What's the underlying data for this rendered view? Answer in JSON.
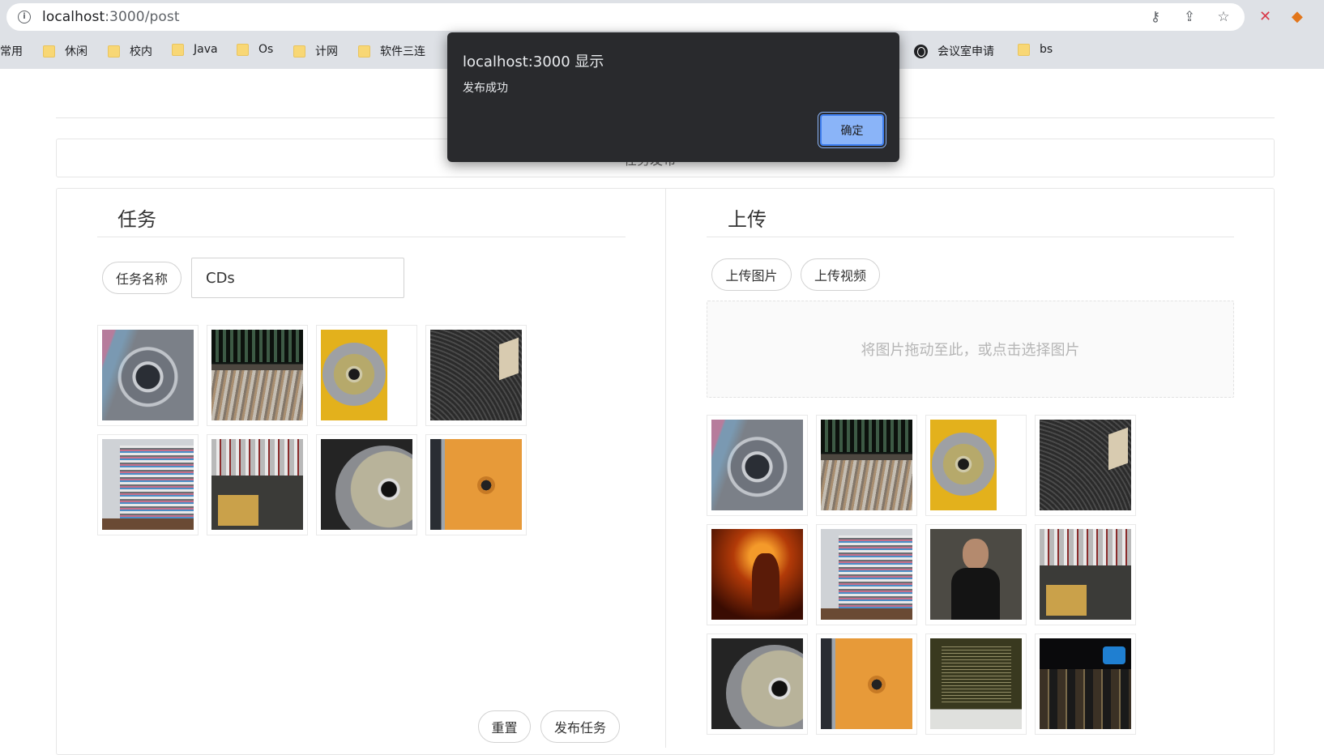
{
  "browser": {
    "url_host": "localhost",
    "url_path": ":3000/post",
    "bookmarks": [
      "常用",
      "休闲",
      "校内",
      "Java",
      "Os",
      "计网",
      "软件三连",
      "会议室申请",
      "bs"
    ]
  },
  "banner_text": "任务发布",
  "task": {
    "title": "任务",
    "name_label": "任务名称",
    "name_value": "CDs",
    "reset_label": "重置",
    "publish_label": "发布任务",
    "images": [
      "cd-case",
      "record-shelf",
      "gold-cd",
      "vinyl",
      "cd-store",
      "store-bins",
      "cd-in-case",
      "orange-cd"
    ]
  },
  "upload": {
    "title": "上传",
    "upload_image_label": "上传图片",
    "upload_video_label": "上传视频",
    "drop_hint": "将图片拖动至此，或点击选择图片",
    "images": [
      "cd-case",
      "record-shelf",
      "gold-cd",
      "vinyl",
      "concert",
      "cd-store",
      "person",
      "store-bins",
      "cd-in-case",
      "orange-cd",
      "liner-notes",
      "shop-front"
    ]
  },
  "dialog": {
    "title": "localhost:3000 显示",
    "message": "发布成功",
    "ok_label": "确定"
  },
  "colors": {
    "dialog_bg": "#292a2d",
    "ok_button": "#8ab4f8"
  }
}
